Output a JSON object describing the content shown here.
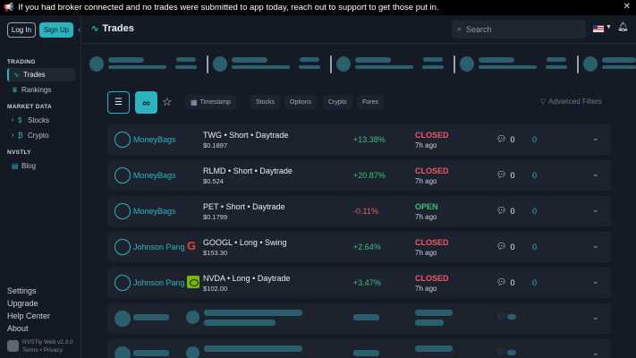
{
  "banner": {
    "text": "If you had broker connected and no trades were submitted to app today, reach out to support to get those put in.",
    "close": "✕"
  },
  "auth": {
    "login": "Log In",
    "signup": "Sign Up"
  },
  "sidebar": {
    "trading_head": "TRADING",
    "trading": [
      {
        "label": "Trades",
        "icon": "pulse-icon"
      },
      {
        "label": "Rankings",
        "icon": "crown-icon"
      }
    ],
    "market_head": "MARKET DATA",
    "market": [
      {
        "label": "Stocks",
        "icon": "dollar-icon"
      },
      {
        "label": "Crypto",
        "icon": "bitcoin-icon"
      }
    ],
    "nvstly_head": "NVSTLY",
    "nvstly": [
      {
        "label": "Blog",
        "icon": "newspaper-icon"
      }
    ],
    "footer": {
      "settings": "Settings",
      "upgrade": "Upgrade",
      "help": "Help Center",
      "about": "About"
    },
    "version": "NVSTly Web v2.3.0",
    "legal": "Terms • Privacy"
  },
  "header": {
    "title": "Trades",
    "search_placeholder": "Search"
  },
  "toolbar": {
    "chips": [
      "Timestamp",
      "Stocks",
      "Options",
      "Crypto",
      "Forex"
    ],
    "advanced": "Advanced Filters"
  },
  "trades": [
    {
      "user": "MoneyBags",
      "logo": "none",
      "info": "TWG • Short • Daytrade",
      "price": "$0.1897",
      "pct": "+13.38%",
      "status": "CLOSED",
      "ago": "7h ago",
      "comments": "0",
      "likes": "0"
    },
    {
      "user": "MoneyBags",
      "logo": "none",
      "info": "RLMD • Short • Daytrade",
      "price": "$0.524",
      "pct": "+20.87%",
      "status": "CLOSED",
      "ago": "7h ago",
      "comments": "0",
      "likes": "0"
    },
    {
      "user": "MoneyBags",
      "logo": "none",
      "info": "PET • Short • Daytrade",
      "price": "$0.1799",
      "pct": "-0.11%",
      "status": "OPEN",
      "ago": "7h ago",
      "comments": "0",
      "likes": "0"
    },
    {
      "user": "Johnson Pang",
      "logo": "google-logo",
      "info": "GOOGL • Long • Swing",
      "price": "$153.30",
      "pct": "+2.64%",
      "status": "CLOSED",
      "ago": "7h ago",
      "comments": "0",
      "likes": "0"
    },
    {
      "user": "Johnson Pang",
      "logo": "nvidia-logo",
      "info": "NVDA • Long • Daytrade",
      "price": "$102.00",
      "pct": "+3.47%",
      "status": "CLOSED",
      "ago": "7h ago",
      "comments": "0",
      "likes": "0"
    }
  ],
  "colors": {
    "accent": "#2bb3c0",
    "positive": "#3fbf7f",
    "negative": "#f05a67",
    "open": "#3fbf7f",
    "closed": "#f05a67"
  }
}
